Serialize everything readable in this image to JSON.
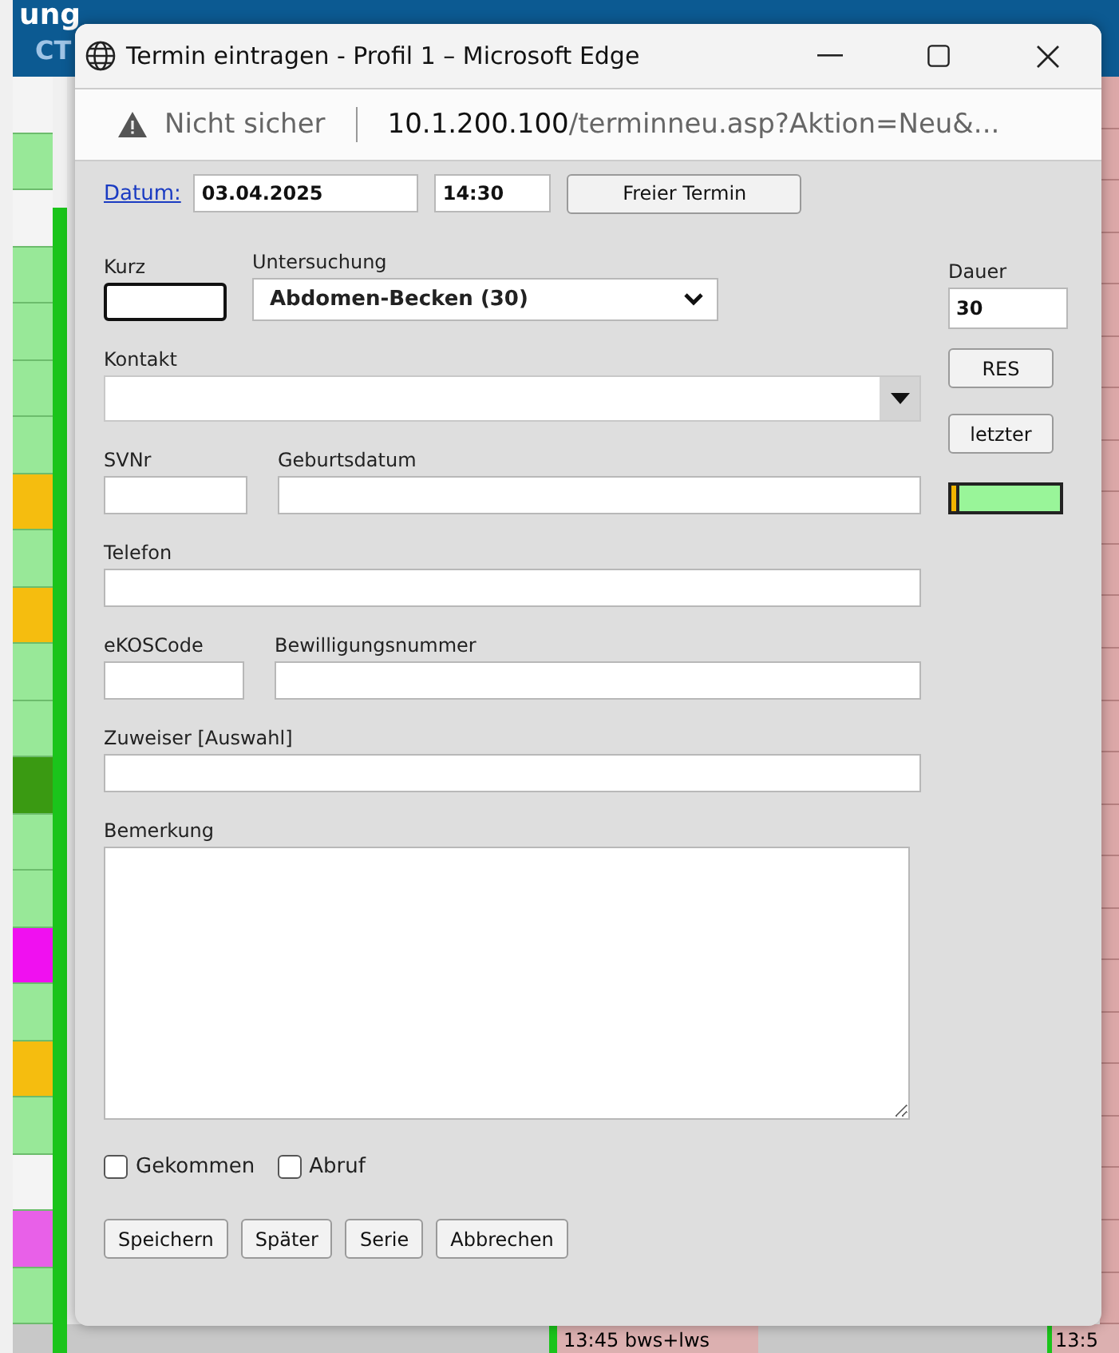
{
  "background": {
    "header_text": "ung",
    "header_sub": "CT",
    "left_cells": [
      {
        "color": "#f4f4f4"
      },
      {
        "color": "#98e898"
      },
      {
        "color": "#f4f4f4"
      },
      {
        "color": "#98e898"
      },
      {
        "color": "#98e898"
      },
      {
        "color": "#98e898"
      },
      {
        "color": "#98e898"
      },
      {
        "color": "#f5bd0f"
      },
      {
        "color": "#98e898"
      },
      {
        "color": "#f5bd0f"
      },
      {
        "color": "#98e898"
      },
      {
        "color": "#98e898"
      },
      {
        "color": "#3a9a12"
      },
      {
        "color": "#98e898"
      },
      {
        "color": "#98e898"
      },
      {
        "color": "#f010f0"
      },
      {
        "color": "#98e898"
      },
      {
        "color": "#f5bd0f"
      },
      {
        "color": "#98e898"
      },
      {
        "color": "#f4f4f4"
      },
      {
        "color": "#e860e8"
      },
      {
        "color": "#98e898"
      }
    ],
    "bottom_entries": [
      "13:45 bws+lws",
      "13:5"
    ]
  },
  "window": {
    "title": "Termin eintragen - Profil 1 – Microsoft Edge",
    "security": "Nicht sicher",
    "url_host": "10.1.200.100",
    "url_path": "/terminneu.asp?Aktion=Neu&..."
  },
  "form": {
    "date_link": "Datum:",
    "date": "03.04.2025",
    "time": "14:30",
    "free_button": "Freier Termin",
    "kurz": {
      "label": "Kurz"
    },
    "untersuchung": {
      "label": "Untersuchung",
      "value": "Abdomen-Becken (30)"
    },
    "dauer": {
      "label": "Dauer",
      "value": "30"
    },
    "kontakt": {
      "label": "Kontakt"
    },
    "side_buttons": [
      "RES",
      "letzter"
    ],
    "indicator": {
      "level": 0.05
    },
    "svnr": {
      "label": "SVNr"
    },
    "geburtsdatum": {
      "label": "Geburtsdatum"
    },
    "telefon": {
      "label": "Telefon"
    },
    "ekos": {
      "label": "eKOSCode"
    },
    "bewilligung": {
      "label": "Bewilligungsnummer"
    },
    "zuweiser": {
      "label": "Zuweiser [Auswahl]"
    },
    "bemerkung": {
      "label": "Bemerkung"
    },
    "checkboxes": [
      {
        "label": "Gekommen",
        "checked": false
      },
      {
        "label": "Abruf",
        "checked": false
      }
    ],
    "buttons": [
      "Speichern",
      "Später",
      "Serie",
      "Abbrechen"
    ]
  }
}
